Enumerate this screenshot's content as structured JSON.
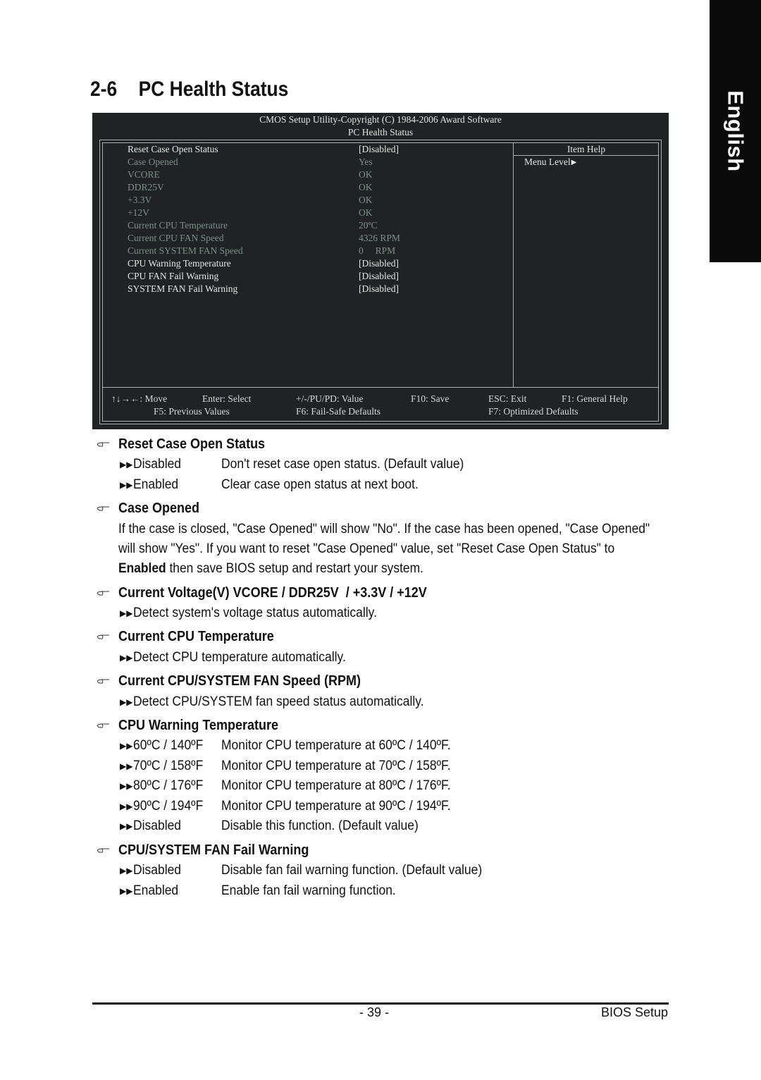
{
  "side_tab": "English",
  "title": {
    "number": "2-6",
    "text": "PC Health Status"
  },
  "bios": {
    "header_line1": "CMOS Setup Utility-Copyright (C) 1984-2006 Award Software",
    "header_line2": "PC Health Status",
    "item_help_title": "Item Help",
    "menu_level": "Menu Level",
    "items": [
      {
        "label": "Reset Case Open Status",
        "value": "[Disabled]",
        "state": "active"
      },
      {
        "label": "Case Opened",
        "value": "Yes",
        "state": "dim"
      },
      {
        "label": "VCORE",
        "value": "OK",
        "state": "dim"
      },
      {
        "label": "DDR25V",
        "value": "OK",
        "state": "dim"
      },
      {
        "label": "+3.3V",
        "value": "OK",
        "state": "dim"
      },
      {
        "label": "+12V",
        "value": "OK",
        "state": "dim"
      },
      {
        "label": "Current CPU Temperature",
        "value": "20ºC",
        "state": "dim"
      },
      {
        "label": "Current CPU FAN Speed",
        "value": "4326 RPM",
        "state": "dim"
      },
      {
        "label": "Current SYSTEM FAN Speed",
        "value": "0     RPM",
        "state": "dim"
      },
      {
        "label": "CPU Warning Temperature",
        "value": "[Disabled]",
        "state": "active"
      },
      {
        "label": "CPU FAN Fail Warning",
        "value": "[Disabled]",
        "state": "active"
      },
      {
        "label": "SYSTEM FAN Fail Warning",
        "value": "[Disabled]",
        "state": "active"
      }
    ],
    "footer": {
      "move": "↑↓→←: Move",
      "select": "Enter: Select",
      "value": "+/-/PU/PD: Value",
      "save": "F10: Save",
      "exit": "ESC: Exit",
      "help": "F1: General Help",
      "previous": "F5: Previous Values",
      "failsafe": "F6: Fail-Safe Defaults",
      "optimized": "F7: Optimized Defaults"
    }
  },
  "sections": {
    "reset_case": {
      "heading": "Reset Case Open Status",
      "options": [
        {
          "key": "Disabled",
          "desc": "Don't reset case open status. (Default value)"
        },
        {
          "key": "Enabled",
          "desc": "Clear case open status at next boot."
        }
      ]
    },
    "case_opened": {
      "heading": "Case Opened",
      "line1": "If the case is closed, \"Case Opened\" will show \"No\". If the case has been opened, \"Case Opened\"",
      "line2": "will show \"Yes\". If you want to reset \"Case Opened\" value, set \"Reset Case Open Status\" to",
      "line3_bold": "Enabled",
      "line3_rest": " then save BIOS setup and restart your system."
    },
    "voltage": {
      "heading": "Current Voltage(V) VCORE / DDR25V  / +3.3V / +12V",
      "desc": "Detect system's voltage status automatically."
    },
    "cpu_temp": {
      "heading": "Current CPU Temperature",
      "desc": "Detect CPU temperature automatically."
    },
    "fan_speed": {
      "heading": "Current CPU/SYSTEM FAN Speed (RPM)",
      "desc": "Detect CPU/SYSTEM fan speed status automatically."
    },
    "warning_temp": {
      "heading": "CPU Warning Temperature",
      "options": [
        {
          "key": "60ºC / 140ºF",
          "desc": "Monitor CPU temperature at 60ºC / 140ºF."
        },
        {
          "key": "70ºC / 158ºF",
          "desc": "Monitor CPU temperature at 70ºC / 158ºF."
        },
        {
          "key": "80ºC / 176ºF",
          "desc": "Monitor CPU temperature at 80ºC / 176ºF."
        },
        {
          "key": "90ºC / 194ºF",
          "desc": "Monitor CPU temperature at 90ºC / 194ºF."
        },
        {
          "key": "Disabled",
          "desc": "Disable this function. (Default value)"
        }
      ]
    },
    "fan_fail": {
      "heading": "CPU/SYSTEM FAN Fail Warning",
      "options": [
        {
          "key": "Disabled",
          "desc": "Disable fan fail warning function. (Default value)"
        },
        {
          "key": "Enabled",
          "desc": "Enable fan fail warning function."
        }
      ]
    }
  },
  "footer": {
    "page": "- 39 -",
    "section": "BIOS Setup"
  }
}
